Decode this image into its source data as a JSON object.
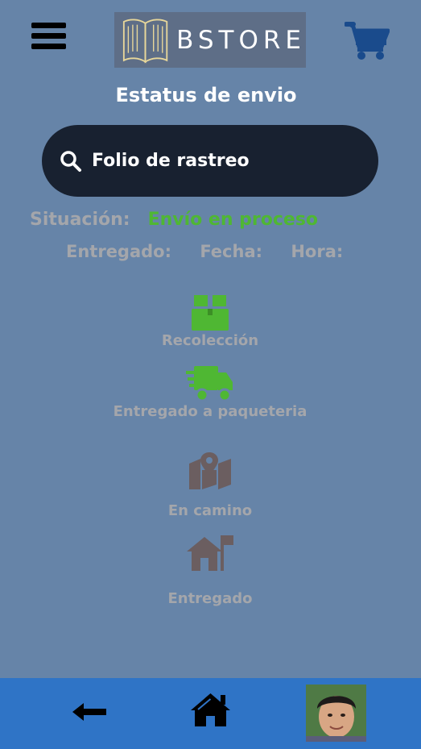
{
  "header": {
    "menu_icon": "hamburger-icon",
    "logo_icon": "open-book-icon",
    "logo_text": "BSTORE",
    "cart_icon": "shopping-cart-icon"
  },
  "page_title": "Estatus de envio",
  "search": {
    "icon": "search-icon",
    "placeholder": "Folio de rastreo"
  },
  "status": {
    "label": "Situación:",
    "value": "Envío en proceso"
  },
  "meta": {
    "delivered_label": "Entregado:",
    "date_label": "Fecha:",
    "time_label": "Hora:"
  },
  "steps": [
    {
      "label": "Recolección",
      "icon": "box-icon",
      "active": true
    },
    {
      "label": "Entregado a paqueteria",
      "icon": "fast-truck-icon",
      "active": true
    },
    {
      "label": "En camino",
      "icon": "map-pin-icon",
      "active": false
    },
    {
      "label": "Entregado",
      "icon": "house-flag-icon",
      "active": false
    }
  ],
  "colors": {
    "background": "#6684a8",
    "search_bg": "#182130",
    "active_green": "#4fb733",
    "inactive_brown": "#6b5e60",
    "muted_text": "#a4a6ab",
    "bottom_bar": "#2f74c6",
    "cart_blue": "#1a4b8c"
  },
  "bottom_nav": {
    "back_icon": "arrow-left-icon",
    "home_icon": "home-icon",
    "avatar": "user-avatar"
  }
}
